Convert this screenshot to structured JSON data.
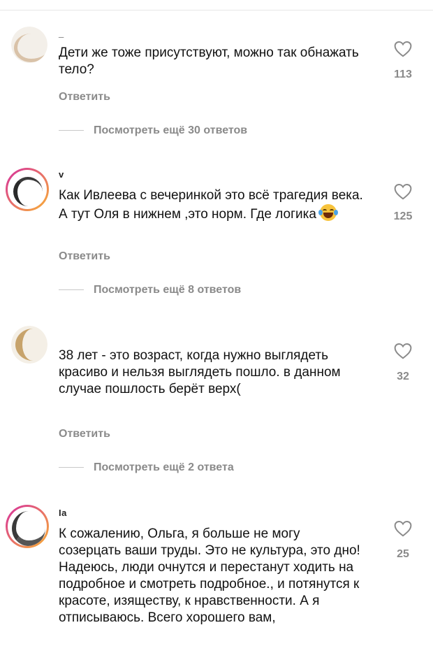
{
  "comments": [
    {
      "username": "_",
      "text": "Дети же тоже присутствуют, можно так обнажать тело?",
      "likes": "113",
      "reply_label": "Ответить",
      "more_replies": "Посмотреть ещё 30 ответов",
      "has_story_ring": false
    },
    {
      "username": "v",
      "text": "Как Ивлеева с вечеринкой это всё трагедия века. А тут Оля в нижнем ,это норм. Где логика",
      "emoji": "laughing-tears-emoji",
      "likes": "125",
      "reply_label": "Ответить",
      "more_replies": "Посмотреть ещё 8 ответов",
      "has_story_ring": true
    },
    {
      "username": "",
      "text": "38 лет - это возраст, когда нужно выглядеть красиво и нельзя выглядеть пошло. в данном случае пошлость берёт верх(",
      "likes": "32",
      "reply_label": "Ответить",
      "more_replies": "Посмотреть ещё 2 ответа",
      "has_story_ring": false
    },
    {
      "username": "Ia",
      "text": "К сожалению, Ольга, я больше не могу созерцать ваши труды. Это не культура, это дно! Надеюсь, люди очнутся и перестанут ходить на подробное и смотреть подробное., и потянутся к красоте, изяществу, к нравственности. А я отписываюсь. Всего хорошего вам,",
      "likes": "25",
      "has_story_ring": true
    }
  ],
  "icons": {
    "like": "heart-outline-icon"
  },
  "colors": {
    "secondary_text": "#8a8a8a",
    "story_ring_start": "#f9b233",
    "story_ring_end": "#d62e9e"
  }
}
